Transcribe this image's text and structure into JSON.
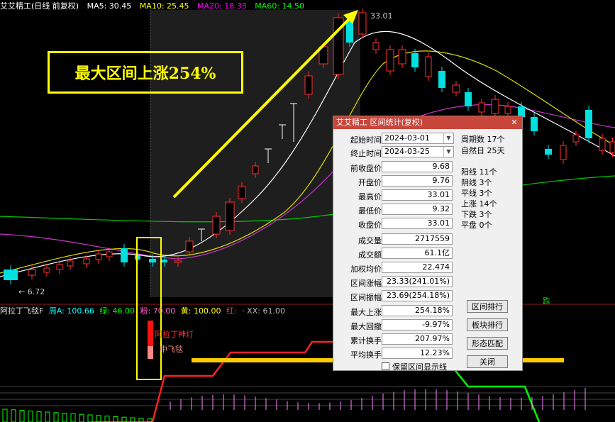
{
  "header": {
    "title": "艾艾精工(日线 前复权)",
    "ma5": "MA5: 30.45",
    "ma10": "MA10: 25.45",
    "ma20": "MA20: 18.33",
    "ma60": "MA60: 14.50",
    "colors": {
      "ma5": "#ffffff",
      "ma10": "#ffff00",
      "ma20": "#ff00ff",
      "ma60": "#00ff00"
    }
  },
  "chart_labels": {
    "high": "33.01",
    "low": "6.72",
    "tag_die": "跌"
  },
  "annotation": {
    "text": "最大区间上涨254%"
  },
  "indicator": {
    "name": "阿拉丁飞毯F",
    "zhou": "周A: 100.66",
    "lv": "绿: 46.00",
    "fen": "粉: 70.00",
    "huang": "黄: 100.00",
    "hong": "红:",
    "xx": "· XX: 61.00",
    "signal1": "阿拉丁神灯",
    "signal2": "中飞毯"
  },
  "dialog": {
    "title": "艾艾精工 区间统计(复权)",
    "start_label": "起始时间",
    "start": "2024-03-01",
    "end_label": "终止时间",
    "end": "2024-03-25",
    "fields": [
      {
        "k": "前收盘价",
        "v": "9.68"
      },
      {
        "k": "开盘价",
        "v": "9.76"
      },
      {
        "k": "最高价",
        "v": "33.01"
      },
      {
        "k": "最低价",
        "v": "9.32"
      },
      {
        "k": "收盘价",
        "v": "33.01"
      },
      {
        "k": "成交量",
        "v": "2717559"
      },
      {
        "k": "成交额",
        "v": "61.1亿"
      },
      {
        "k": "加权均价",
        "v": "22.474"
      },
      {
        "k": "区间涨幅",
        "v": "23.33(241.01%)"
      },
      {
        "k": "区间振幅",
        "v": "23.69(254.18%)"
      },
      {
        "k": "最大上涨",
        "v": "254.18%"
      },
      {
        "k": "最大回撤",
        "v": "-9.97%"
      },
      {
        "k": "累计换手",
        "v": "207.97%"
      },
      {
        "k": "平均换手",
        "v": "12.23%"
      }
    ],
    "stats_top": [
      "周期数 17个",
      "自然日 25天"
    ],
    "stats": [
      "阳线 11个",
      "阴线 3个",
      "平线 3个",
      "上涨 14个",
      "下跌 3个",
      "平盘 0个"
    ],
    "buttons": {
      "rank": "区间排行",
      "sector": "板块排行",
      "pattern": "形态匹配",
      "close": "关闭"
    },
    "checkbox": "保留区间显示线"
  }
}
